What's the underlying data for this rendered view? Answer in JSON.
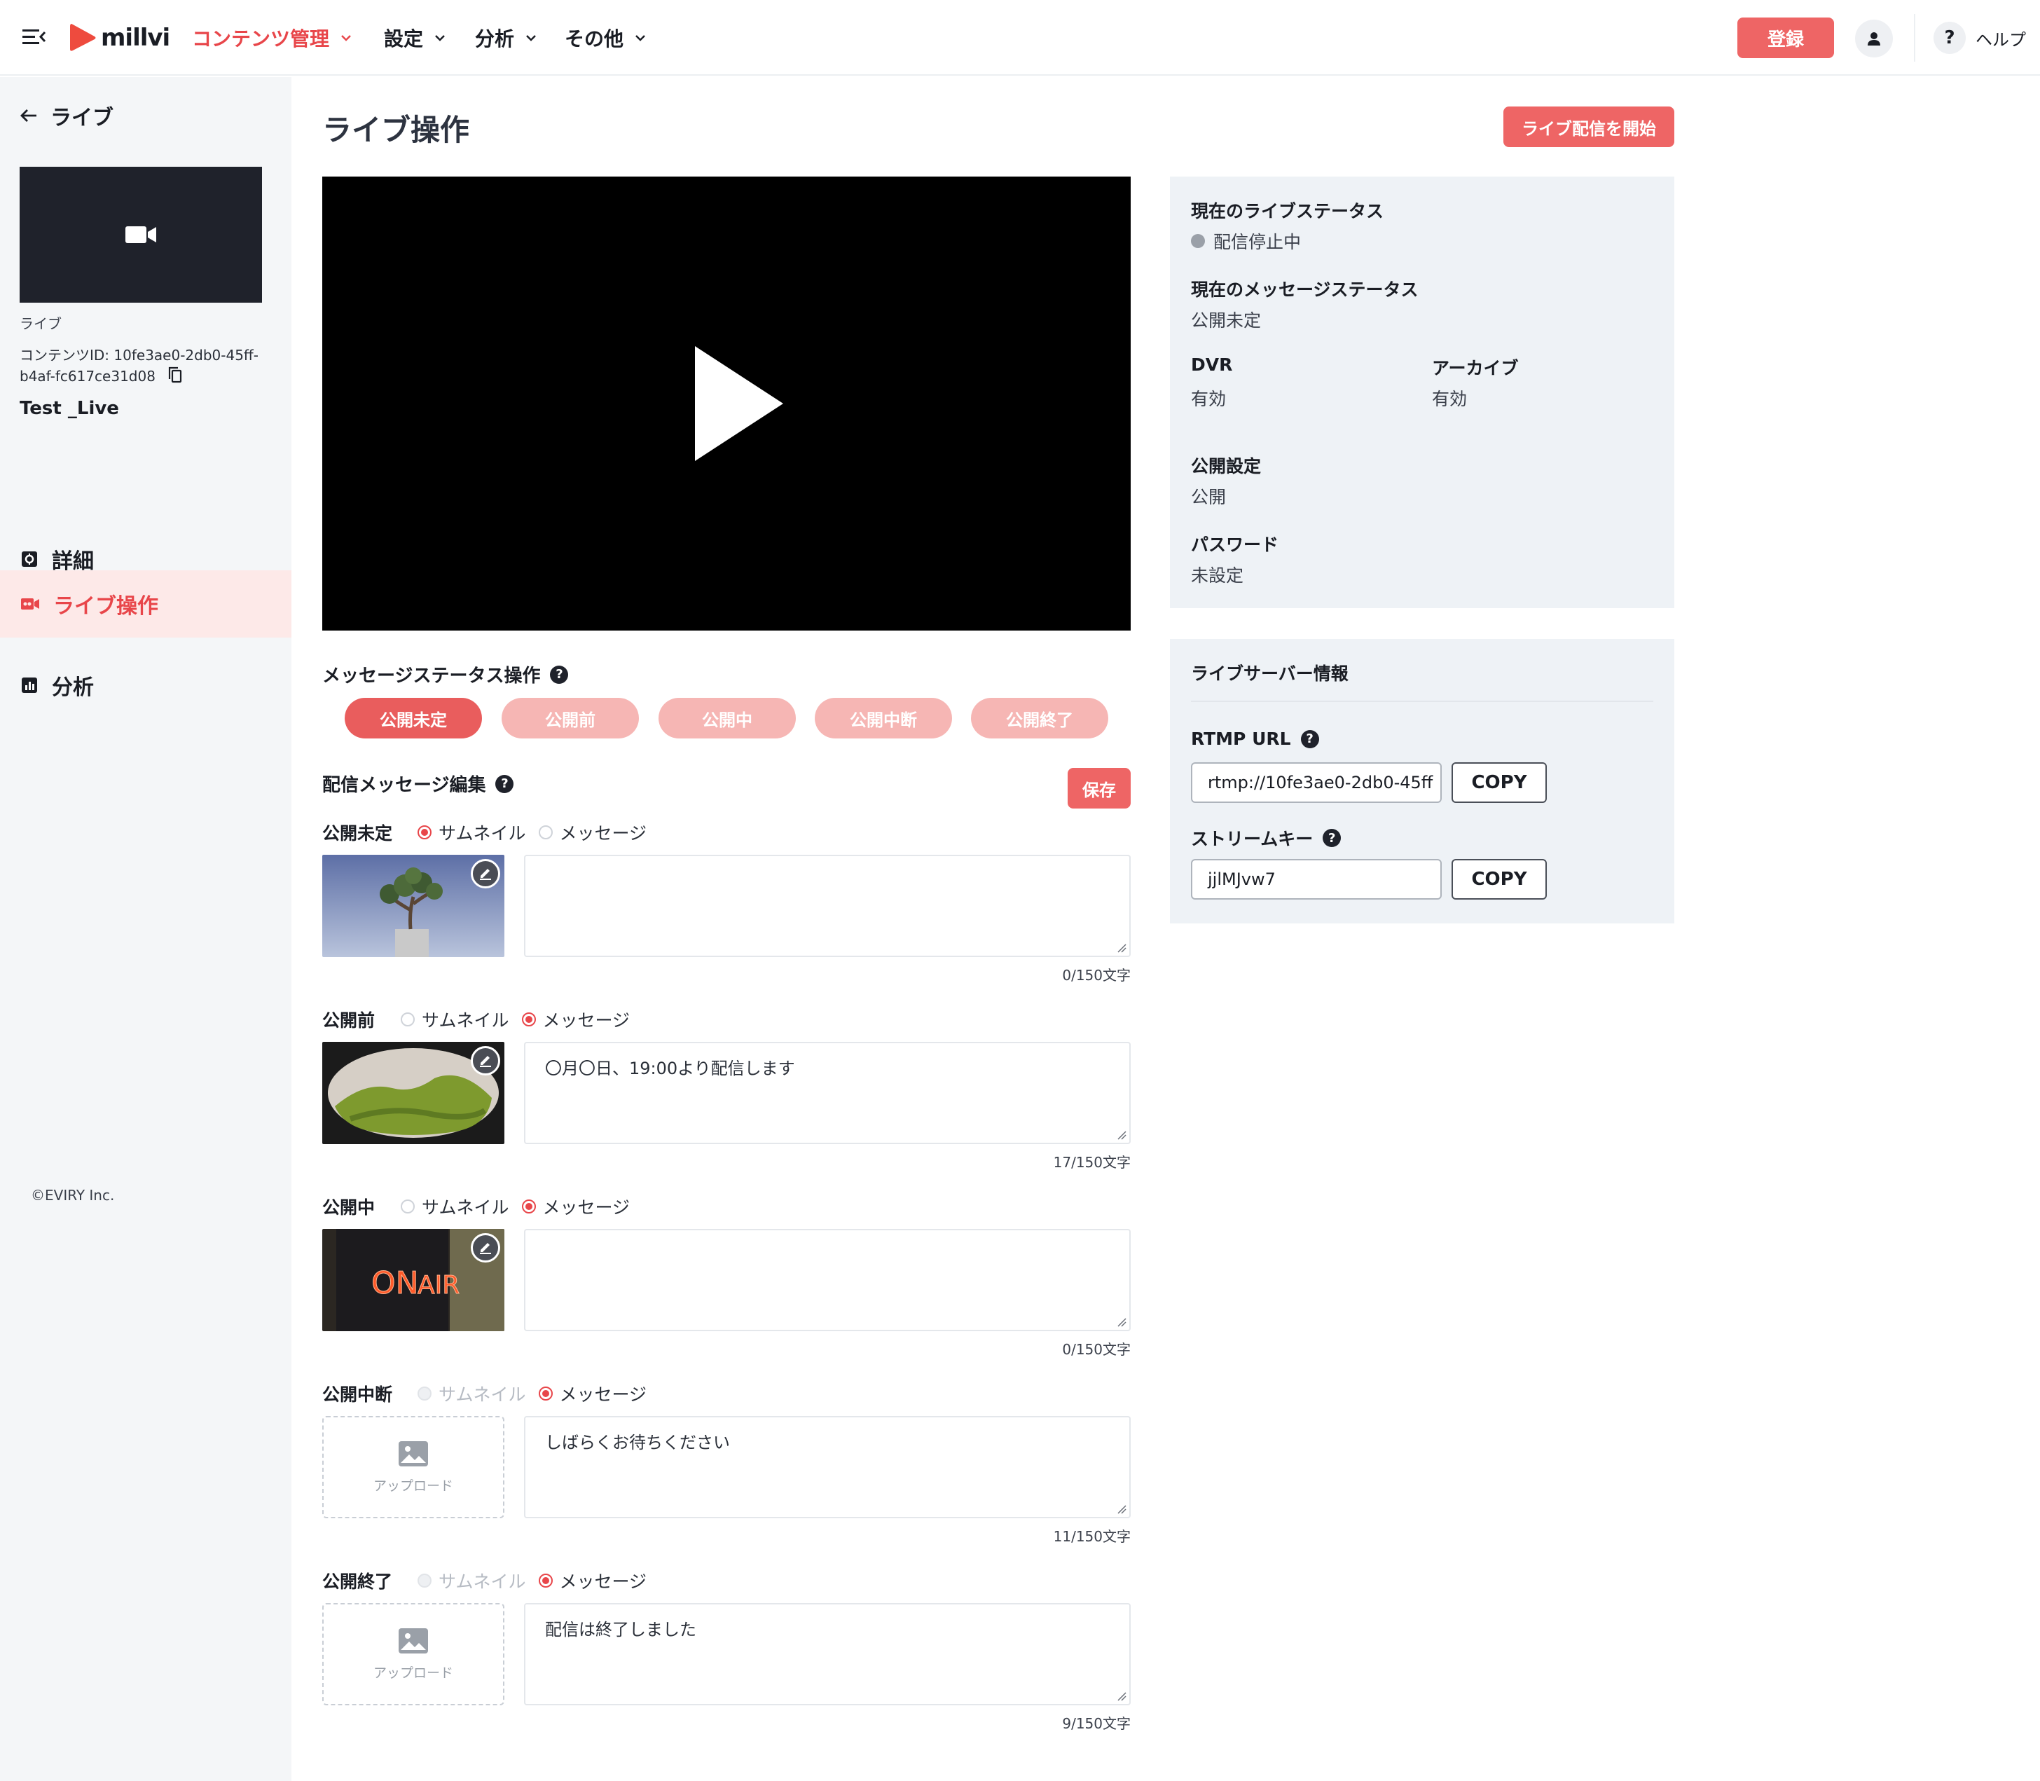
{
  "header": {
    "logo_text": "millvi",
    "nav": [
      {
        "label": "コンテンツ管理",
        "active": true
      },
      {
        "label": "設定",
        "active": false
      },
      {
        "label": "分析",
        "active": false
      },
      {
        "label": "その他",
        "active": false
      }
    ],
    "register_label": "登録",
    "help_label": "ヘルプ",
    "help_icon": "?"
  },
  "sidebar": {
    "back_label": "ライブ",
    "content_type": "ライブ",
    "content_id": "コンテンツID: 10fe3ae0-2db0-45ff-b4af-fc617ce31d08",
    "content_title": "Test _Live",
    "nav_items": [
      {
        "label": "詳細",
        "icon": "info-square-icon",
        "active": false
      },
      {
        "label": "ライブ操作",
        "icon": "video-camera-icon",
        "active": true
      },
      {
        "label": "分析",
        "icon": "bar-chart-icon",
        "active": false
      }
    ],
    "copyright": "©EVIRY Inc."
  },
  "main": {
    "title": "ライブ操作",
    "start_button": "ライブ配信を開始",
    "message_status_heading": "メッセージステータス操作",
    "status_pills": [
      {
        "label": "公開未定",
        "active": true
      },
      {
        "label": "公開前",
        "active": false
      },
      {
        "label": "公開中",
        "active": false
      },
      {
        "label": "公開中断",
        "active": false
      },
      {
        "label": "公開終了",
        "active": false
      }
    ],
    "message_edit_heading": "配信メッセージ編集",
    "save_button": "保存",
    "radio_thumbnail": "サムネイル",
    "radio_message": "メッセージ",
    "upload_label": "アップロード",
    "messages": [
      {
        "status": "公開未定",
        "mode": "thumbnail",
        "thumbnail_enabled": true,
        "text": "",
        "counter": "0/150文字"
      },
      {
        "status": "公開前",
        "mode": "message",
        "thumbnail_enabled": true,
        "text": "〇月〇日、19:00より配信します",
        "counter": "17/150文字"
      },
      {
        "status": "公開中",
        "mode": "message",
        "thumbnail_enabled": true,
        "text": "",
        "counter": "0/150文字"
      },
      {
        "status": "公開中断",
        "mode": "message",
        "thumbnail_enabled": false,
        "text": "しばらくお待ちください",
        "counter": "11/150文字"
      },
      {
        "status": "公開終了",
        "mode": "message",
        "thumbnail_enabled": false,
        "text": "配信は終了しました",
        "counter": "9/150文字"
      }
    ]
  },
  "status_panel": {
    "live_status_label": "現在のライブステータス",
    "live_status_value": "配信停止中",
    "message_status_label": "現在のメッセージステータス",
    "message_status_value": "公開未定",
    "dvr_label": "DVR",
    "dvr_value": "有効",
    "archive_label": "アーカイブ",
    "archive_value": "有効",
    "publish_label": "公開設定",
    "publish_value": "公開",
    "password_label": "パスワード",
    "password_value": "未設定"
  },
  "server_panel": {
    "heading": "ライブサーバー情報",
    "rtmp_label": "RTMP URL",
    "rtmp_value": "rtmp://10fe3ae0-2db0-45ff",
    "stream_key_label": "ストリームキー",
    "stream_key_value": "jjlMJvw7",
    "copy_label": "COPY"
  },
  "colors": {
    "accent": "#e8464a",
    "button": "#ee6565",
    "pill_inactive": "#f6b6b4",
    "panel_bg": "#eef2f6",
    "sidebar_bg": "#f4f6f8"
  }
}
